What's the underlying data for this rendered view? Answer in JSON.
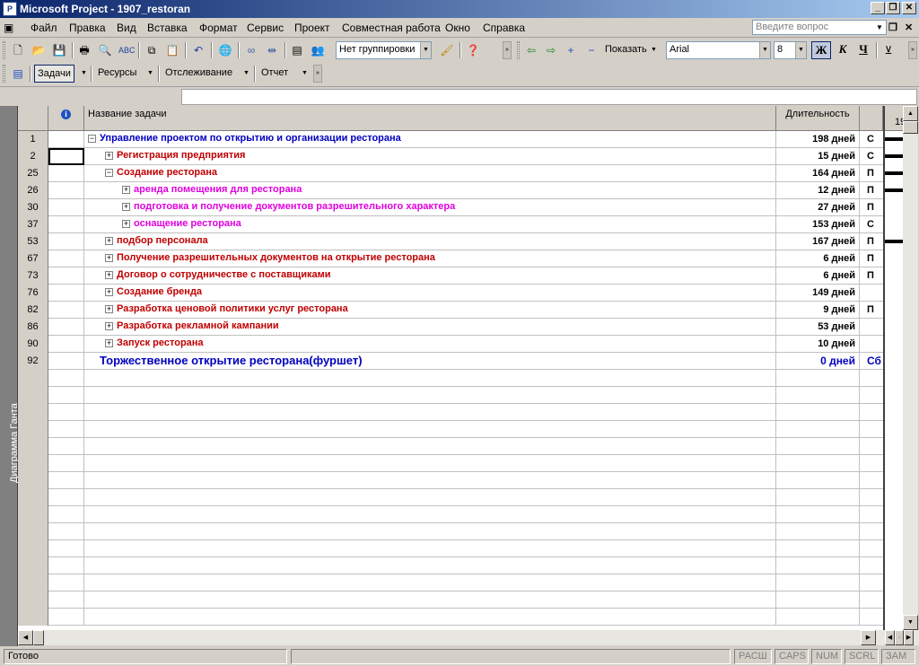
{
  "window": {
    "app_icon": "project-icon",
    "title": "Microsoft Project - 1907_restoran"
  },
  "menu": {
    "items": [
      "Файл",
      "Правка",
      "Вид",
      "Вставка",
      "Формат",
      "Сервис",
      "Проект",
      "Совместная работа",
      "Окно",
      "Справка"
    ],
    "ask_placeholder": "Введите вопрос"
  },
  "toolbar": {
    "grouping_value": "Нет группировки",
    "show_label": "Показать",
    "font_value": "Arial",
    "size_value": "8",
    "bold_label": "Ж",
    "italic_label": "К",
    "underline_label": "Ч"
  },
  "guide_toolbar": {
    "tasks": "Задачи",
    "resources": "Ресурсы",
    "tracking": "Отслеживание",
    "report": "Отчет"
  },
  "view_bar": {
    "label": "Диаграмма Ганта"
  },
  "table": {
    "headers": {
      "indicators": "i",
      "name": "Название задачи",
      "duration": "Длительность"
    },
    "rows": [
      {
        "id": "1",
        "name": "Управление проектом по открытию и организации ресторана",
        "duration": "198 дней",
        "start": "С",
        "outline": "minus",
        "level": 0,
        "color": "blue"
      },
      {
        "id": "2",
        "name": "Регистрация предприятия",
        "duration": "15 дней",
        "start": "С",
        "outline": "plus",
        "level": 1,
        "color": "red"
      },
      {
        "id": "25",
        "name": "Создание ресторана",
        "duration": "164 дней",
        "start": "П",
        "outline": "minus",
        "level": 1,
        "color": "red"
      },
      {
        "id": "26",
        "name": "аренда помещения для ресторана",
        "duration": "12 дней",
        "start": "П",
        "outline": "plus",
        "level": 2,
        "color": "magenta"
      },
      {
        "id": "30",
        "name": "подготовка и получение документов разрешительного характера",
        "duration": "27 дней",
        "start": "П",
        "outline": "plus",
        "level": 2,
        "color": "magenta"
      },
      {
        "id": "37",
        "name": "оснащение ресторана",
        "duration": "153 дней",
        "start": "С",
        "outline": "plus",
        "level": 2,
        "color": "magenta"
      },
      {
        "id": "53",
        "name": "подбор персонала",
        "duration": "167 дней",
        "start": "П",
        "outline": "plus",
        "level": 1,
        "color": "red"
      },
      {
        "id": "67",
        "name": "Получение разрешительных документов на открытие ресторана",
        "duration": "6 дней",
        "start": "П",
        "outline": "plus",
        "level": 1,
        "color": "red"
      },
      {
        "id": "73",
        "name": "Договор о сотрудничестве с поставщиками",
        "duration": "6 дней",
        "start": "П",
        "outline": "plus",
        "level": 1,
        "color": "red"
      },
      {
        "id": "76",
        "name": "Создание бренда",
        "duration": "149 дней",
        "start": "",
        "outline": "plus",
        "level": 1,
        "color": "red"
      },
      {
        "id": "82",
        "name": "Разработка ценовой политики услуг ресторана",
        "duration": "9 дней",
        "start": "П",
        "outline": "plus",
        "level": 1,
        "color": "red"
      },
      {
        "id": "86",
        "name": "Разработка рекламной кампании",
        "duration": "53 дней",
        "start": "",
        "outline": "plus",
        "level": 1,
        "color": "red"
      },
      {
        "id": "90",
        "name": "Запуск ресторана",
        "duration": "10 дней",
        "start": "",
        "outline": "plus",
        "level": 1,
        "color": "red"
      },
      {
        "id": "92",
        "name": "Торжественное открытие ресторана(фуршет)",
        "duration": "0 дней",
        "start": "Сб",
        "outline": "none",
        "level": 0,
        "color": "milestone"
      }
    ]
  },
  "gantt": {
    "timescale_label": "19"
  },
  "status": {
    "ready": "Готово",
    "ext": "РАСШ",
    "caps": "CAPS",
    "num": "NUM",
    "scrl": "SCRL",
    "ovr": "ЗАМ"
  }
}
